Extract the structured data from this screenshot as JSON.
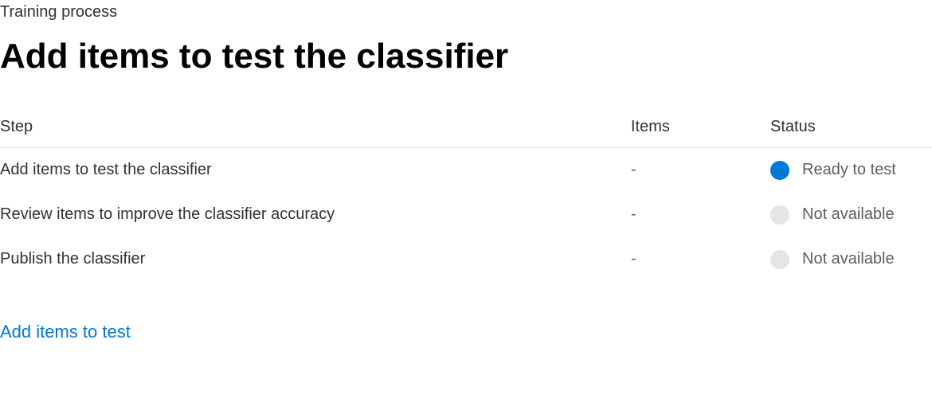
{
  "breadcrumb": "Training process",
  "page_title": "Add items to test the classifier",
  "table": {
    "headers": {
      "step": "Step",
      "items": "Items",
      "status": "Status"
    },
    "rows": [
      {
        "step": "Add items to test the classifier",
        "items": "-",
        "status_text": "Ready to test",
        "status_active": true
      },
      {
        "step": "Review items to improve the classifier accuracy",
        "items": "-",
        "status_text": "Not available",
        "status_active": false
      },
      {
        "step": "Publish the classifier",
        "items": "-",
        "status_text": "Not available",
        "status_active": false
      }
    ]
  },
  "action_link": "Add items to test",
  "colors": {
    "primary": "#0078d4",
    "inactive_dot": "#e5e5e5",
    "text_primary": "#323130",
    "text_secondary": "#605e5c"
  }
}
